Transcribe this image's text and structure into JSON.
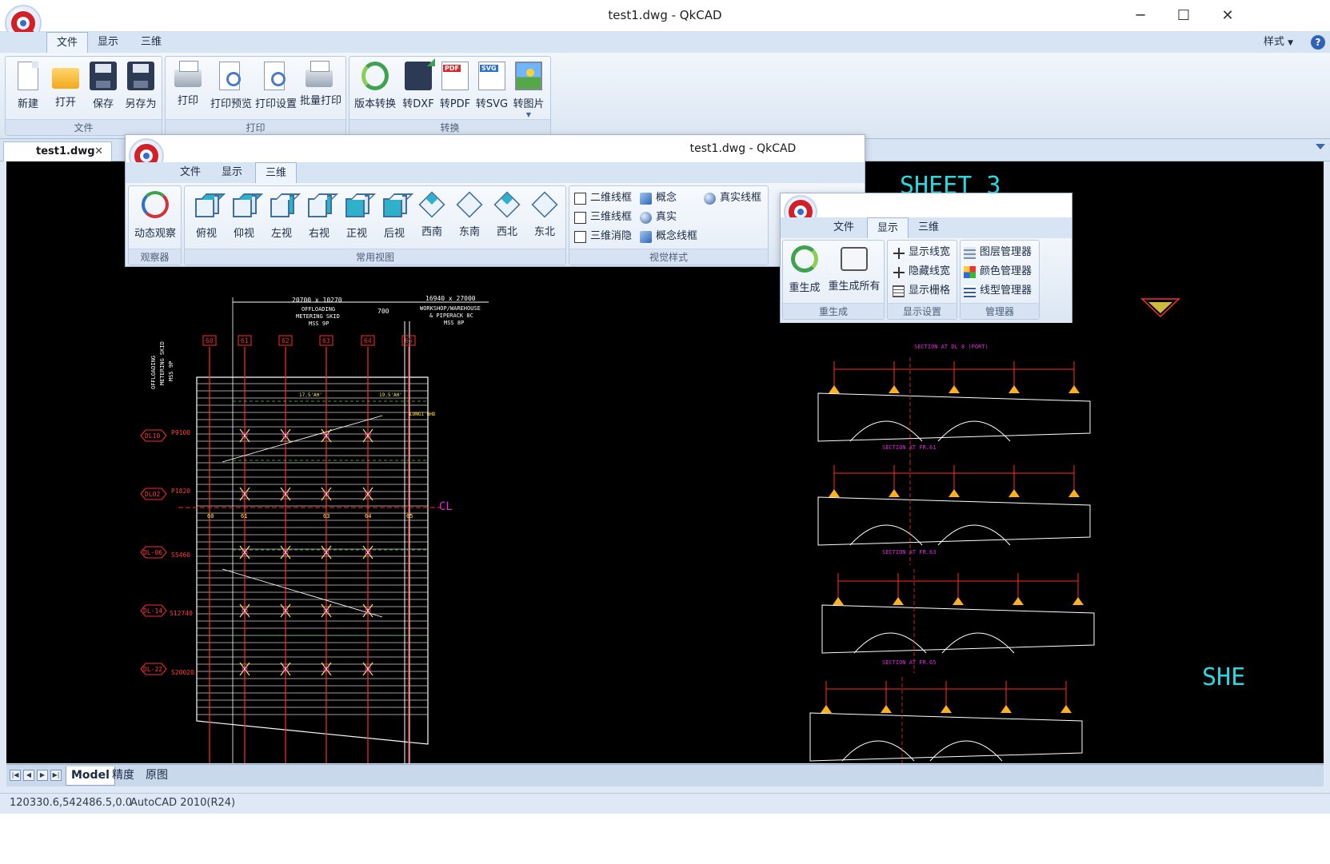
{
  "window": {
    "title": "test1.dwg - QkCAD",
    "minimize": "─",
    "maximize": "☐",
    "close": "✕"
  },
  "menu": {
    "tabs": [
      "文件",
      "显示",
      "三维"
    ],
    "active": "文件",
    "style_label": "样式",
    "help": "?"
  },
  "ribbon": {
    "groups": [
      {
        "label": "文件",
        "buttons": [
          "新建",
          "打开",
          "保存",
          "另存为"
        ]
      },
      {
        "label": "打印",
        "buttons": [
          "打印",
          "打印预览",
          "打印设置",
          "批量打印"
        ]
      },
      {
        "label": "转换",
        "buttons": [
          "版本转换",
          "转DXF",
          "转PDF",
          "转SVG",
          "转图片"
        ]
      }
    ]
  },
  "document_tab": {
    "name": "test1.dwg",
    "close": "✕"
  },
  "sheets": {
    "tabs": [
      "Model",
      "精度",
      "原图"
    ],
    "active": "Model"
  },
  "status": {
    "coords": "120330.6,542486.5,0.0",
    "format": "AutoCAD 2010(R24)"
  },
  "window_3d": {
    "title": "test1.dwg - QkCAD",
    "tabs": [
      "文件",
      "显示",
      "三维"
    ],
    "active": "三维",
    "groups": [
      {
        "label": "观察器",
        "buttons": [
          "动态观察"
        ]
      },
      {
        "label": "常用视图",
        "buttons": [
          "俯视",
          "仰视",
          "左视",
          "右视",
          "正视",
          "后视",
          "西南",
          "东南",
          "西北",
          "东北"
        ]
      },
      {
        "label": "视觉样式",
        "items": [
          "二维线框",
          "三维线框",
          "三维消隐",
          "概念",
          "真实",
          "概念线框",
          "真实线框"
        ]
      }
    ]
  },
  "window_display": {
    "tabs": [
      "文件",
      "显示",
      "三维"
    ],
    "active": "显示",
    "groups": [
      {
        "label": "重生成",
        "buttons": [
          "重生成",
          "重生成所有"
        ]
      },
      {
        "label": "显示设置",
        "items": [
          "显示线宽",
          "隐藏线宽",
          "显示栅格"
        ]
      },
      {
        "label": "管理器",
        "items": [
          "图层管理器",
          "颜色管理器",
          "线型管理器"
        ]
      }
    ]
  },
  "drawing": {
    "sheet_title": "SHEET 3",
    "sheet_title_partial": "SHE",
    "plan": {
      "dim_left": "20700 x 10270",
      "left_note": [
        "OFFLOADING",
        "METERING SKID",
        "MSS 9P"
      ],
      "dim_right": "16940 x 27000",
      "right_note": [
        "WORKSHOP/WAREHOUSE",
        "& PIPERACK 8C",
        "MSS 8P"
      ],
      "gap": "700",
      "side_label": [
        "OFFLOADING",
        "METERING SKID",
        "MSS 9P"
      ],
      "grid_bubbles": [
        "60",
        "61",
        "62",
        "63",
        "64",
        "65"
      ],
      "levels": [
        {
          "tag": "DL10",
          "value": "P9100"
        },
        {
          "tag": "DL02",
          "value": "P1820"
        },
        {
          "tag": "DL-06",
          "value": "S5460"
        },
        {
          "tag": "DL-14",
          "value": "S12740"
        },
        {
          "tag": "DL-22",
          "value": "S20020"
        }
      ],
      "centerline": "CL",
      "row_labels": [
        "60",
        "61",
        "63",
        "64",
        "65"
      ],
      "notes": [
        "17.5'AH'",
        "19.5'AH'",
        "LONGI BHD"
      ]
    },
    "sections": [
      "SECTION AT DL 8 (PORT)",
      "SECTION AT FR.61",
      "SECTION AT FR.63",
      "SECTION AT FR.65"
    ]
  }
}
